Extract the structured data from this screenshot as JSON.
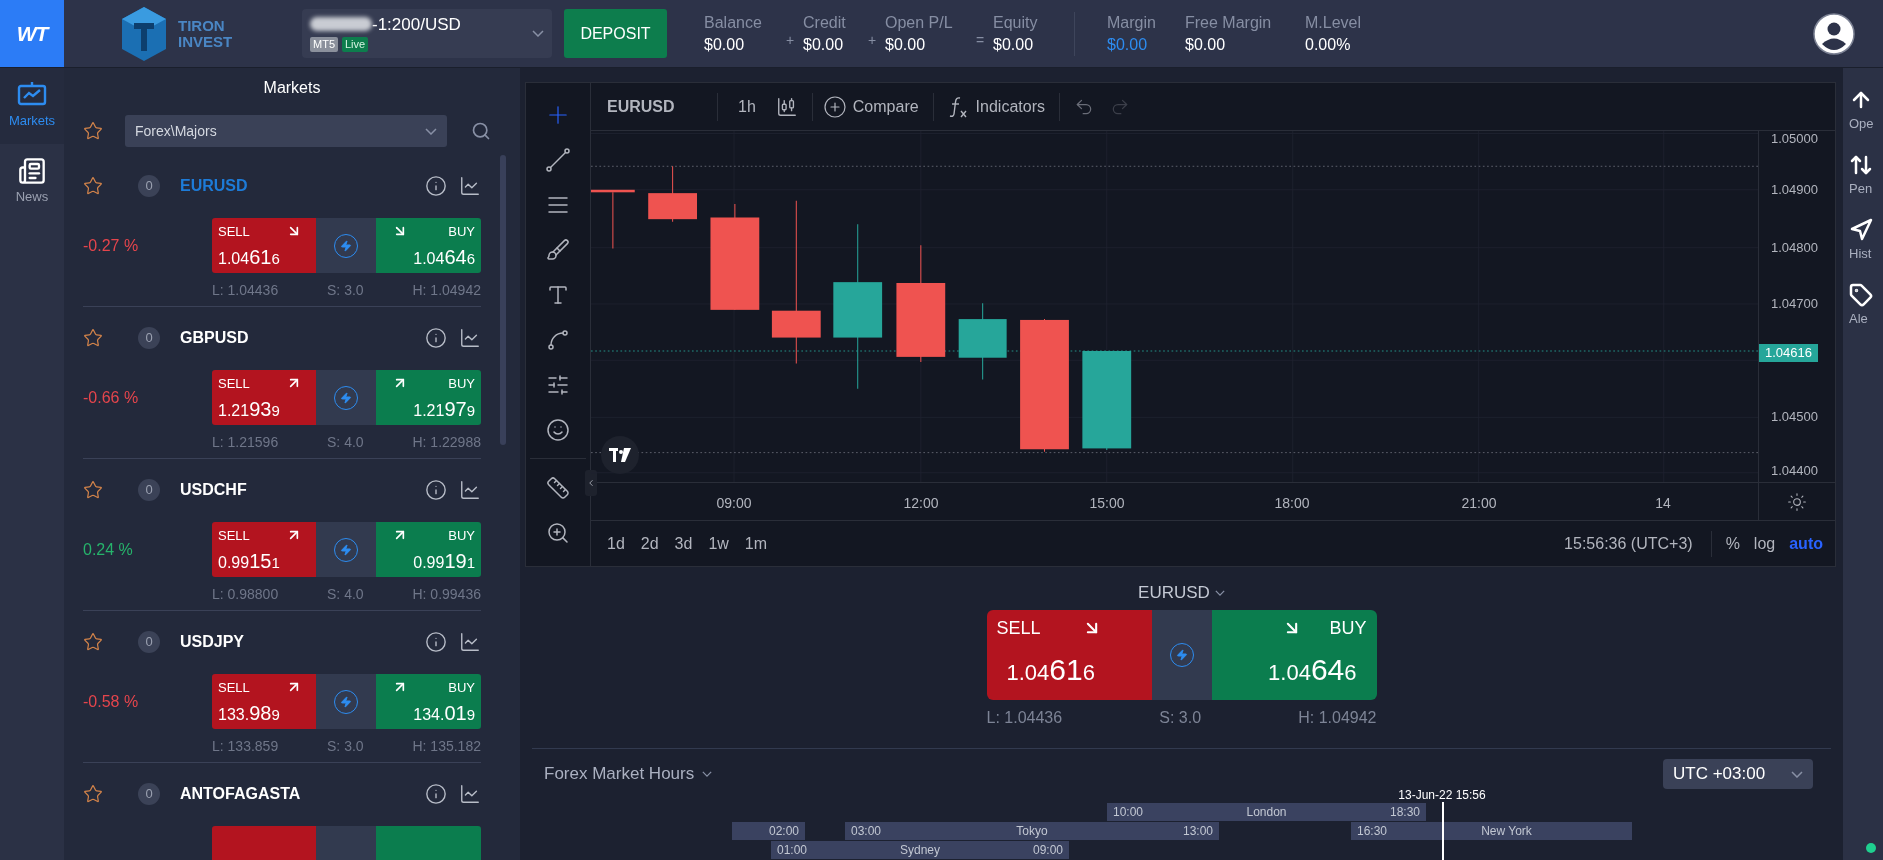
{
  "top_bar": {
    "logo": "WT",
    "brand": [
      "TIRON",
      "INVEST"
    ],
    "account": {
      "name": "-1:200/USD",
      "platform": "MT5",
      "status": "Live"
    },
    "deposit": "DEPOSIT",
    "stats": [
      {
        "label": "Balance",
        "value": "$0.00",
        "accent": false,
        "op": "+"
      },
      {
        "label": "Credit",
        "value": "$0.00",
        "accent": false,
        "op": "+"
      },
      {
        "label": "Open P/L",
        "value": "$0.00",
        "accent": false,
        "op": "="
      },
      {
        "label": "Equity",
        "value": "$0.00",
        "accent": false
      }
    ],
    "margin_stats": [
      {
        "label": "Margin",
        "value": "$0.00",
        "accent": true
      },
      {
        "label": "Free Margin",
        "value": "$0.00",
        "accent": false
      },
      {
        "label": "M.Level",
        "value": "0.00%",
        "accent": false
      }
    ]
  },
  "nav": [
    {
      "label": "Markets",
      "kind": "markets",
      "selected": true
    },
    {
      "label": "News",
      "kind": "news",
      "selected": false
    }
  ],
  "markets": {
    "title": "Markets",
    "filter": "Forex\\Majors",
    "items": [
      {
        "symbol": "EURUSD",
        "count": "0",
        "favorite": false,
        "selected": true,
        "change": "-0.27 %",
        "positive": false,
        "quote": {
          "down": true,
          "sell": {
            "label": "SELL",
            "lead": "1.04",
            "big": "61",
            "tail": "6"
          },
          "buy": {
            "label": "BUY",
            "lead": "1.04",
            "big": "64",
            "tail": "6"
          },
          "low": "L: 1.04436",
          "spread": "S: 3.0",
          "high": "H: 1.04942"
        }
      },
      {
        "symbol": "GBPUSD",
        "count": "0",
        "favorite": false,
        "selected": false,
        "change": "-0.66 %",
        "positive": false,
        "quote": {
          "down": false,
          "sell": {
            "label": "SELL",
            "lead": "1.21",
            "big": "93",
            "tail": "9"
          },
          "buy": {
            "label": "BUY",
            "lead": "1.21",
            "big": "97",
            "tail": "9"
          },
          "low": "L: 1.21596",
          "spread": "S: 4.0",
          "high": "H: 1.22988"
        }
      },
      {
        "symbol": "USDCHF",
        "count": "0",
        "favorite": false,
        "selected": false,
        "change": "0.24 %",
        "positive": true,
        "quote": {
          "down": false,
          "sell": {
            "label": "SELL",
            "lead": "0.99",
            "big": "15",
            "tail": "1"
          },
          "buy": {
            "label": "BUY",
            "lead": "0.99",
            "big": "19",
            "tail": "1"
          },
          "low": "L: 0.98800",
          "spread": "S: 4.0",
          "high": "H: 0.99436"
        }
      },
      {
        "symbol": "USDJPY",
        "count": "0",
        "favorite": false,
        "selected": false,
        "change": "-0.58 %",
        "positive": false,
        "quote": {
          "down": false,
          "sell": {
            "label": "SELL",
            "lead": "133.",
            "big": "98",
            "tail": "9"
          },
          "buy": {
            "label": "BUY",
            "lead": "134.",
            "big": "01",
            "tail": "9"
          },
          "low": "L: 133.859",
          "spread": "S: 3.0",
          "high": "H: 135.182"
        }
      },
      {
        "symbol": "ANTOFAGASTA",
        "count": "0",
        "favorite": false,
        "selected": false
      }
    ]
  },
  "chart": {
    "symbol": "EURUSD",
    "interval": "1h",
    "compare": "Compare",
    "indicators": "Indicators",
    "price_labels": [
      "1.05000",
      "1.04900",
      "1.04800",
      "1.04700",
      "1.04500",
      "1.04400"
    ],
    "last_price": "1.04616",
    "time_labels": [
      "09:00",
      "12:00",
      "15:00",
      "18:00",
      "21:00",
      "14"
    ],
    "ranges": [
      "1d",
      "2d",
      "3d",
      "1w",
      "1m"
    ],
    "clock": "15:56:36 (UTC+3)",
    "scale_options": [
      {
        "label": "%",
        "selected": false
      },
      {
        "label": "log",
        "selected": false
      },
      {
        "label": "auto",
        "selected": true
      }
    ]
  },
  "trade": {
    "symbol": "EURUSD",
    "quote": {
      "down": true,
      "sell": {
        "label": "SELL",
        "lead": "1.04",
        "big": "61",
        "tail": "6"
      },
      "buy": {
        "label": "BUY",
        "lead": "1.04",
        "big": "64",
        "tail": "6"
      },
      "low": "L: 1.04436",
      "spread": "S: 3.0",
      "high": "H: 1.04942"
    }
  },
  "market_hours": {
    "title": "Forex Market Hours",
    "timezone": "UTC +03:00",
    "now": "13-Jun-22 15:56",
    "sessions": [
      {
        "name": "London",
        "open": "10:00",
        "close": "18:30"
      },
      {
        "close": "02:00"
      },
      {
        "name": "Tokyo",
        "open": "03:00",
        "close": "13:00"
      },
      {
        "name": "New York",
        "open": "16:30"
      },
      {
        "name": "Sydney",
        "open": "01:00",
        "close": "09:00"
      }
    ]
  },
  "right_bar": {
    "items": [
      {
        "label": "Ope",
        "kind": "open"
      },
      {
        "label": "Pen",
        "kind": "pending"
      },
      {
        "label": "Hist",
        "kind": "history"
      },
      {
        "label": "Ale",
        "kind": "alerts"
      }
    ],
    "connected": true
  }
}
